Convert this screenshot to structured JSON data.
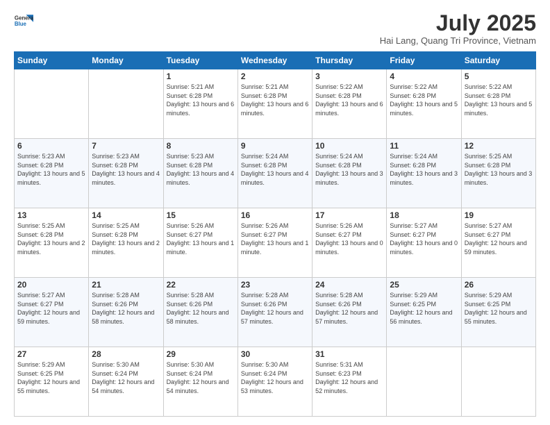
{
  "logo": {
    "line1": "General",
    "line2": "Blue"
  },
  "title": "July 2025",
  "subtitle": "Hai Lang, Quang Tri Province, Vietnam",
  "days_of_week": [
    "Sunday",
    "Monday",
    "Tuesday",
    "Wednesday",
    "Thursday",
    "Friday",
    "Saturday"
  ],
  "weeks": [
    [
      {
        "day": "",
        "info": ""
      },
      {
        "day": "",
        "info": ""
      },
      {
        "day": "1",
        "info": "Sunrise: 5:21 AM\nSunset: 6:28 PM\nDaylight: 13 hours and 6 minutes."
      },
      {
        "day": "2",
        "info": "Sunrise: 5:21 AM\nSunset: 6:28 PM\nDaylight: 13 hours and 6 minutes."
      },
      {
        "day": "3",
        "info": "Sunrise: 5:22 AM\nSunset: 6:28 PM\nDaylight: 13 hours and 6 minutes."
      },
      {
        "day": "4",
        "info": "Sunrise: 5:22 AM\nSunset: 6:28 PM\nDaylight: 13 hours and 5 minutes."
      },
      {
        "day": "5",
        "info": "Sunrise: 5:22 AM\nSunset: 6:28 PM\nDaylight: 13 hours and 5 minutes."
      }
    ],
    [
      {
        "day": "6",
        "info": "Sunrise: 5:23 AM\nSunset: 6:28 PM\nDaylight: 13 hours and 5 minutes."
      },
      {
        "day": "7",
        "info": "Sunrise: 5:23 AM\nSunset: 6:28 PM\nDaylight: 13 hours and 4 minutes."
      },
      {
        "day": "8",
        "info": "Sunrise: 5:23 AM\nSunset: 6:28 PM\nDaylight: 13 hours and 4 minutes."
      },
      {
        "day": "9",
        "info": "Sunrise: 5:24 AM\nSunset: 6:28 PM\nDaylight: 13 hours and 4 minutes."
      },
      {
        "day": "10",
        "info": "Sunrise: 5:24 AM\nSunset: 6:28 PM\nDaylight: 13 hours and 3 minutes."
      },
      {
        "day": "11",
        "info": "Sunrise: 5:24 AM\nSunset: 6:28 PM\nDaylight: 13 hours and 3 minutes."
      },
      {
        "day": "12",
        "info": "Sunrise: 5:25 AM\nSunset: 6:28 PM\nDaylight: 13 hours and 3 minutes."
      }
    ],
    [
      {
        "day": "13",
        "info": "Sunrise: 5:25 AM\nSunset: 6:28 PM\nDaylight: 13 hours and 2 minutes."
      },
      {
        "day": "14",
        "info": "Sunrise: 5:25 AM\nSunset: 6:28 PM\nDaylight: 13 hours and 2 minutes."
      },
      {
        "day": "15",
        "info": "Sunrise: 5:26 AM\nSunset: 6:27 PM\nDaylight: 13 hours and 1 minute."
      },
      {
        "day": "16",
        "info": "Sunrise: 5:26 AM\nSunset: 6:27 PM\nDaylight: 13 hours and 1 minute."
      },
      {
        "day": "17",
        "info": "Sunrise: 5:26 AM\nSunset: 6:27 PM\nDaylight: 13 hours and 0 minutes."
      },
      {
        "day": "18",
        "info": "Sunrise: 5:27 AM\nSunset: 6:27 PM\nDaylight: 13 hours and 0 minutes."
      },
      {
        "day": "19",
        "info": "Sunrise: 5:27 AM\nSunset: 6:27 PM\nDaylight: 12 hours and 59 minutes."
      }
    ],
    [
      {
        "day": "20",
        "info": "Sunrise: 5:27 AM\nSunset: 6:27 PM\nDaylight: 12 hours and 59 minutes."
      },
      {
        "day": "21",
        "info": "Sunrise: 5:28 AM\nSunset: 6:26 PM\nDaylight: 12 hours and 58 minutes."
      },
      {
        "day": "22",
        "info": "Sunrise: 5:28 AM\nSunset: 6:26 PM\nDaylight: 12 hours and 58 minutes."
      },
      {
        "day": "23",
        "info": "Sunrise: 5:28 AM\nSunset: 6:26 PM\nDaylight: 12 hours and 57 minutes."
      },
      {
        "day": "24",
        "info": "Sunrise: 5:28 AM\nSunset: 6:26 PM\nDaylight: 12 hours and 57 minutes."
      },
      {
        "day": "25",
        "info": "Sunrise: 5:29 AM\nSunset: 6:25 PM\nDaylight: 12 hours and 56 minutes."
      },
      {
        "day": "26",
        "info": "Sunrise: 5:29 AM\nSunset: 6:25 PM\nDaylight: 12 hours and 55 minutes."
      }
    ],
    [
      {
        "day": "27",
        "info": "Sunrise: 5:29 AM\nSunset: 6:25 PM\nDaylight: 12 hours and 55 minutes."
      },
      {
        "day": "28",
        "info": "Sunrise: 5:30 AM\nSunset: 6:24 PM\nDaylight: 12 hours and 54 minutes."
      },
      {
        "day": "29",
        "info": "Sunrise: 5:30 AM\nSunset: 6:24 PM\nDaylight: 12 hours and 54 minutes."
      },
      {
        "day": "30",
        "info": "Sunrise: 5:30 AM\nSunset: 6:24 PM\nDaylight: 12 hours and 53 minutes."
      },
      {
        "day": "31",
        "info": "Sunrise: 5:31 AM\nSunset: 6:23 PM\nDaylight: 12 hours and 52 minutes."
      },
      {
        "day": "",
        "info": ""
      },
      {
        "day": "",
        "info": ""
      }
    ]
  ]
}
